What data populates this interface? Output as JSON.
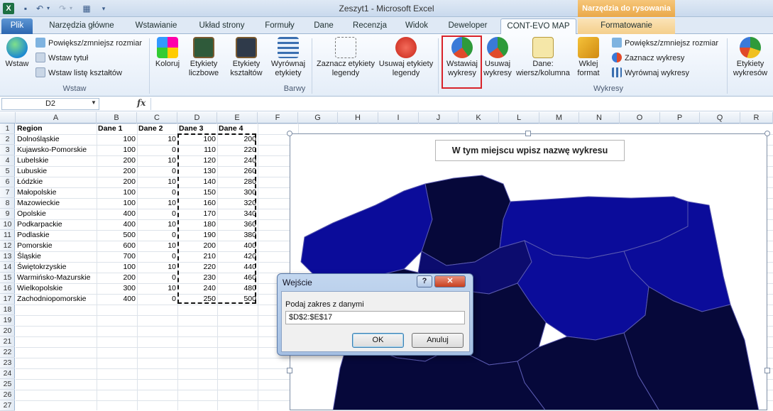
{
  "window": {
    "title": "Zeszyt1 - Microsoft Excel",
    "context_title": "Narzędzia do rysowania"
  },
  "tabs": [
    {
      "label": "Plik"
    },
    {
      "label": "Narzędzia główne"
    },
    {
      "label": "Wstawianie"
    },
    {
      "label": "Układ strony"
    },
    {
      "label": "Formuły"
    },
    {
      "label": "Dane"
    },
    {
      "label": "Recenzja"
    },
    {
      "label": "Widok"
    },
    {
      "label": "Deweloper"
    },
    {
      "label": "CONT-EVO MAP"
    },
    {
      "label": "Formatowanie"
    }
  ],
  "ribbon": {
    "wstaw": "Wstaw",
    "powieksz": "Powiększ/zmniejsz rozmiar",
    "wstaw_tytul": "Wstaw tytuł",
    "wstaw_liste": "Wstaw listę kształtów",
    "koloruj": "Koloruj",
    "etykiety_liczbowe_1": "Etykiety",
    "etykiety_liczbowe_2": "liczbowe",
    "etykiety_ksztaltow_1": "Etykiety",
    "etykiety_ksztaltow_2": "kształtów",
    "wyrownaj_etykiety_1": "Wyrównaj",
    "wyrownaj_etykiety_2": "etykiety",
    "zaznacz_etykiety_1": "Zaznacz etykiety",
    "zaznacz_etykiety_2": "legendy",
    "usuwaj_etykiety_1": "Usuwaj etykiety",
    "usuwaj_etykiety_2": "legendy",
    "wstawiaj_wykresy_1": "Wstawiaj",
    "wstawiaj_wykresy_2": "wykresy",
    "usuwaj_wykresy_1": "Usuwaj",
    "usuwaj_wykresy_2": "wykresy",
    "dane_1": "Dane:",
    "dane_2": "wiersz/kolumna",
    "wklej_1": "Wklej",
    "wklej_2": "format",
    "powieksz_wykresy": "Powiększ/zmniejsz rozmiar",
    "zaznacz_wykresy": "Zaznacz wykresy",
    "wyrownaj_wykresy": "Wyrównaj wykresy",
    "etykiety_wykresow_1": "Etykiety",
    "etykiety_wykresow_2": "wykresów",
    "groups": {
      "wstaw": "Wstaw",
      "barwy": "Barwy",
      "wykresy": "Wykresy"
    }
  },
  "formula_bar": {
    "cell_ref": "D2",
    "fx": "fx"
  },
  "columns": [
    "A",
    "B",
    "C",
    "D",
    "E",
    "F",
    "G",
    "H",
    "I",
    "J",
    "K",
    "L",
    "M",
    "N",
    "O",
    "P",
    "Q",
    "R"
  ],
  "rows": [
    "1",
    "2",
    "3",
    "4",
    "5",
    "6",
    "7",
    "8",
    "9",
    "10",
    "11",
    "12",
    "13",
    "14",
    "15",
    "16",
    "17",
    "18",
    "19",
    "20",
    "21",
    "22",
    "23",
    "24",
    "25",
    "26",
    "27"
  ],
  "sheet": {
    "headers": [
      "Region",
      "Dane 1",
      "Dane 2",
      "Dane 3",
      "Dane 4"
    ],
    "data": [
      [
        "Dolnośląskie",
        "100",
        "10",
        "100",
        "200"
      ],
      [
        "Kujawsko-Pomorskie",
        "100",
        "0",
        "110",
        "220"
      ],
      [
        "Lubelskie",
        "200",
        "10",
        "120",
        "240"
      ],
      [
        "Lubuskie",
        "200",
        "0",
        "130",
        "260"
      ],
      [
        "Łódzkie",
        "200",
        "10",
        "140",
        "280"
      ],
      [
        "Małopolskie",
        "100",
        "0",
        "150",
        "300"
      ],
      [
        "Mazowieckie",
        "100",
        "10",
        "160",
        "320"
      ],
      [
        "Opolskie",
        "400",
        "0",
        "170",
        "340"
      ],
      [
        "Podkarpackie",
        "400",
        "10",
        "180",
        "360"
      ],
      [
        "Podlaskie",
        "500",
        "0",
        "190",
        "380"
      ],
      [
        "Pomorskie",
        "600",
        "10",
        "200",
        "400"
      ],
      [
        "Śląskie",
        "700",
        "0",
        "210",
        "420"
      ],
      [
        "Świętokrzyskie",
        "100",
        "10",
        "220",
        "440"
      ],
      [
        "Warmińsko-Mazurskie",
        "200",
        "0",
        "230",
        "460"
      ],
      [
        "Wielkopolskie",
        "300",
        "10",
        "240",
        "480"
      ],
      [
        "Zachodniopomorskie",
        "400",
        "0",
        "250",
        "500"
      ]
    ]
  },
  "chart": {
    "title": "W tym miejscu wpisz nazwę wykresu"
  },
  "dialog": {
    "title": "Wejście",
    "help": "?",
    "close": "✕",
    "label": "Podaj zakres z danymi",
    "value": "$D$2:$E$17",
    "ok": "OK",
    "cancel": "Anuluj"
  },
  "colors": {
    "map_dark": "#06083a",
    "map_blue": "#0b0c9a",
    "map_mid": "#0c0c6e",
    "highlight": "#d8232a"
  }
}
